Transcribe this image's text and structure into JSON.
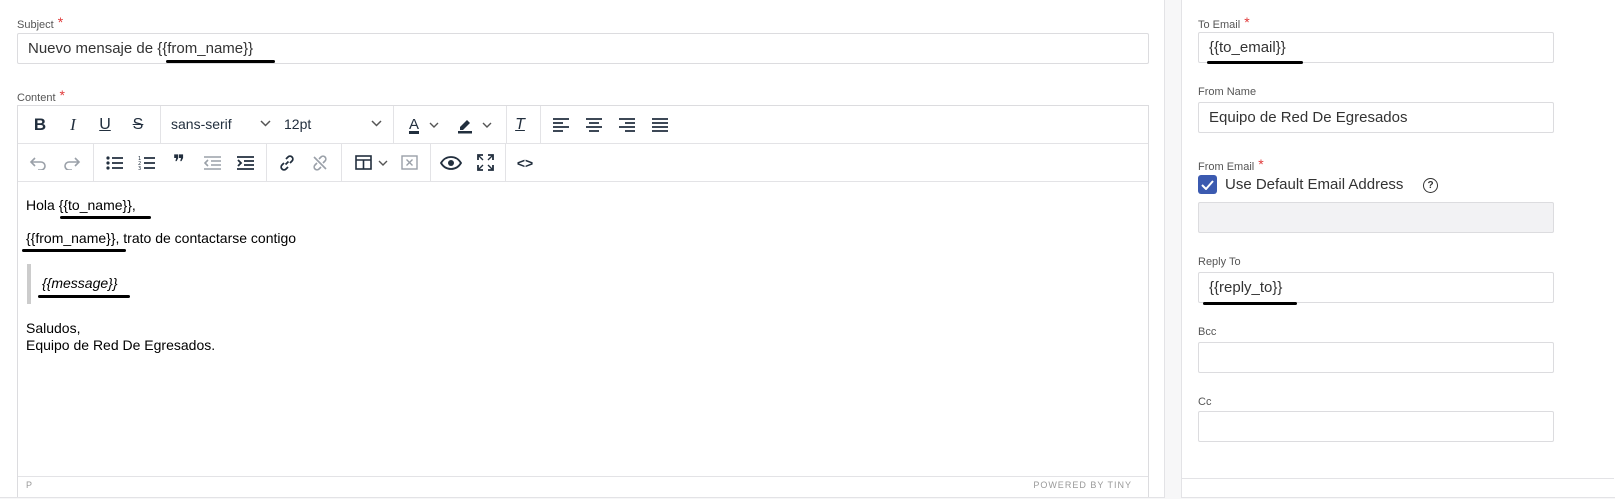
{
  "subject": {
    "label": "Subject",
    "required_mark": "*",
    "value": "Nuevo mensaje de {{from_name}}"
  },
  "content": {
    "label": "Content",
    "required_mark": "*",
    "toolbar": {
      "font_family": "sans-serif",
      "font_size": "12pt",
      "bold_icon": "B",
      "italic_icon": "I",
      "underline_icon": "U",
      "strike_icon": "S",
      "text_color_icon": "A",
      "clear_format_icon": "T",
      "blockquote_icon": "❞",
      "code_icon": "<>"
    },
    "body": {
      "greeting_prefix": "Hola ",
      "to_name": "{{to_name}}",
      "greeting_suffix": ",",
      "from_name": "{{from_name}}",
      "line2_suffix": ", trato de contactarse contigo",
      "message": "{{message}}",
      "closing": "Saludos,",
      "signature": "Equipo de Red De Egresados."
    },
    "status_left": "P",
    "status_right": "POWERED BY TINY"
  },
  "to_email": {
    "label": "To Email",
    "required_mark": "*",
    "value": "{{to_email}}"
  },
  "from_name": {
    "label": "From Name",
    "value": "Equipo de Red De Egresados"
  },
  "from_email": {
    "label": "From Email",
    "required_mark": "*",
    "checkbox_label": "Use Default Email Address",
    "help_icon": "?",
    "checked": true,
    "value": ""
  },
  "reply_to": {
    "label": "Reply To",
    "value": "{{reply_to}}"
  },
  "bcc": {
    "label": "Bcc",
    "value": ""
  },
  "cc": {
    "label": "Cc",
    "value": ""
  },
  "colors": {
    "accent": "#3b5ab0",
    "required": "#e03a3a",
    "toolbar_icon": "#222f3e"
  }
}
